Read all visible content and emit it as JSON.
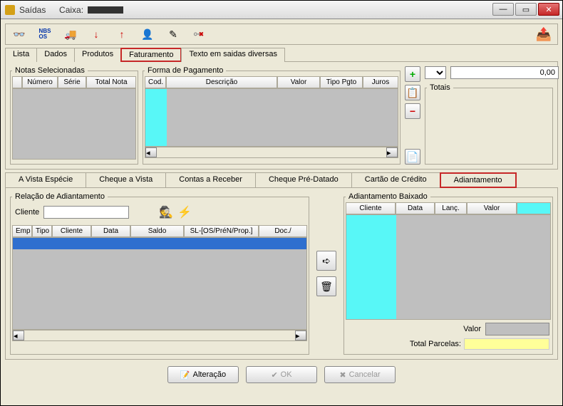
{
  "window": {
    "title": "Saídas",
    "caixa_label": "Caixa:"
  },
  "toolbar": {
    "icons": [
      "glasses",
      "nbs",
      "truck",
      "arrow-down",
      "arrow-up",
      "person",
      "pen",
      "link-broken",
      "exit"
    ]
  },
  "main_tabs": {
    "items": [
      "Lista",
      "Dados",
      "Produtos",
      "Faturamento",
      "Texto em saidas diversas"
    ],
    "active": 3,
    "highlight": 3
  },
  "notas": {
    "legend": "Notas Selecionadas",
    "cols": [
      "Número",
      "Série",
      "Total Nota"
    ]
  },
  "forma": {
    "legend": "Forma de Pagamento",
    "cols": [
      "Cod.",
      "Descrição",
      "Valor",
      "Tipo Pgto",
      "Juros"
    ]
  },
  "top_right": {
    "value": "0,00"
  },
  "totais": {
    "legend": "Totais"
  },
  "sub_tabs": {
    "items": [
      "A Vista Espécie",
      "Cheque a Vista",
      "Contas a Receber",
      "Cheque Pré-Datado",
      "Cartão de Crédito",
      "Adiantamento"
    ],
    "active": 5,
    "highlight": 5
  },
  "relacao": {
    "legend": "Relação de Adiantamento",
    "cliente_label": "Cliente",
    "cols": [
      "Emp",
      "Tipo",
      "Cliente",
      "Data",
      "Saldo",
      "SL-[OS/PréN/Prop.]",
      "Doc./"
    ]
  },
  "baixado": {
    "legend": "Adiantamento Baixado",
    "cols": [
      "Cliente",
      "Data",
      "Lanç.",
      "Valor",
      ""
    ],
    "valor_label": "Valor",
    "total_parcelas_label": "Total Parcelas:"
  },
  "footer": {
    "alteracao": "Alteração",
    "ok": "OK",
    "cancel": "Cancelar"
  }
}
